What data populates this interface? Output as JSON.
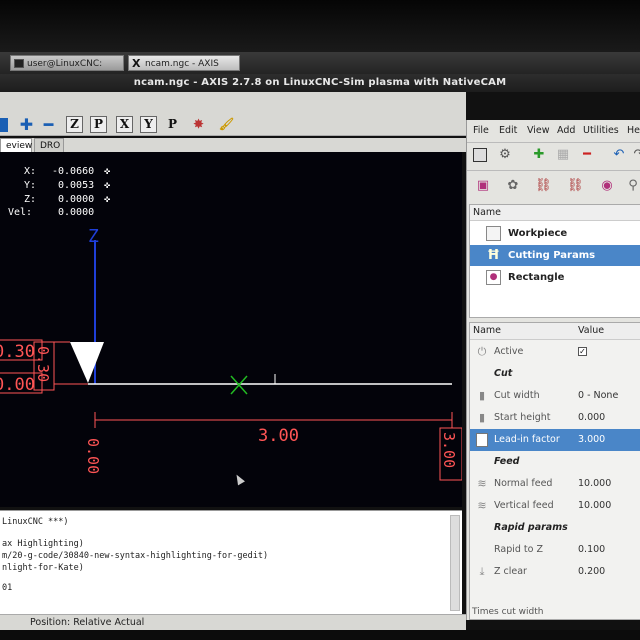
{
  "taskbar": {
    "items": [
      {
        "label": "user@LinuxCNC:"
      },
      {
        "label": "ncam.ngc - AXIS"
      }
    ]
  },
  "window": {
    "title": "ncam.ngc - AXIS 2.7.8 on LinuxCNC-Sim plasma with NativeCAM"
  },
  "toolbar": {
    "buttons": [
      "Z",
      "P",
      "X",
      "Y",
      "P"
    ]
  },
  "tabs": {
    "preview": "eview",
    "dro": "DRO"
  },
  "dro": {
    "x_label": "X:",
    "x_value": "-0.0660",
    "y_label": "Y:",
    "y_value": "0.0053",
    "z_label": "Z:",
    "z_value": "0.0000",
    "vel_label": "Vel:",
    "vel_value": "0.0000"
  },
  "preview": {
    "axis_label": "Z",
    "dim_width": "3.00",
    "dim_left_top": "0.30",
    "dim_left_bottom": "0.00",
    "dim_left_vertical": "0.30",
    "dim_bottom_vertical": "0.00",
    "dim_right_vertical": "3.00"
  },
  "console": {
    "lines": [
      "LinuxCNC ***)",
      "ax Highlighting)",
      "m/20-g-code/30840-new-syntax-highlighting-for-gedit)",
      "nlight-for-Kate)",
      "01"
    ]
  },
  "statusbar": {
    "position": "Position: Relative Actual"
  },
  "ncam": {
    "menu": [
      "File",
      "Edit",
      "View",
      "Add",
      "Utilities",
      "He"
    ],
    "tree_header": "Name",
    "tree": [
      {
        "label": "Workpiece"
      },
      {
        "label": "Cutting Params"
      },
      {
        "label": "Rectangle"
      }
    ],
    "props_header_name": "Name",
    "props_header_value": "Value",
    "props": [
      {
        "label": "Active",
        "value": "✓"
      },
      {
        "label": "Cut",
        "value": ""
      },
      {
        "label": "Cut width",
        "value": "0 - None"
      },
      {
        "label": "Start height",
        "value": "0.000"
      },
      {
        "label": "Lead-in factor",
        "value": "3.000"
      },
      {
        "label": "Feed",
        "value": ""
      },
      {
        "label": "Normal feed",
        "value": "10.000"
      },
      {
        "label": "Vertical feed",
        "value": "10.000"
      },
      {
        "label": "Rapid params",
        "value": ""
      },
      {
        "label": "Rapid to Z",
        "value": "0.100"
      },
      {
        "label": "Z clear",
        "value": "0.200"
      }
    ],
    "footer": "Times cut width"
  }
}
